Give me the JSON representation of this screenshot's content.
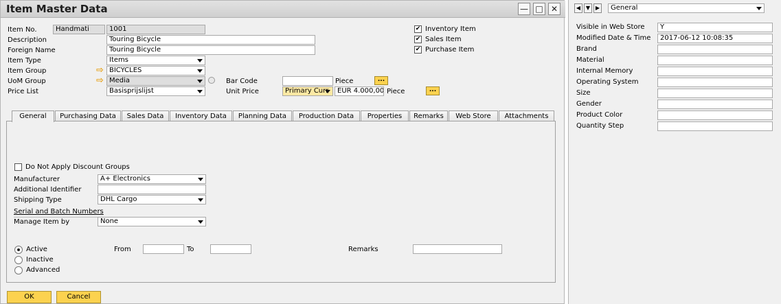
{
  "window": {
    "title": "Item Master Data",
    "minimize": "—",
    "maximize": "□",
    "close": "✕"
  },
  "header": {
    "item_no_label": "Item No.",
    "item_no_series": "Handmati",
    "item_no_value": "1001",
    "description_label": "Description",
    "description_value": "Touring Bicycle",
    "foreign_name_label": "Foreign Name",
    "foreign_name_value": "Touring Bicycle",
    "item_type_label": "Item Type",
    "item_type_value": "Items",
    "item_group_label": "Item Group",
    "item_group_value": "BICYCLES",
    "uom_group_label": "UoM Group",
    "uom_group_value": "Media",
    "price_list_label": "Price List",
    "price_list_value": "Basisprijslijst",
    "bar_code_label": "Bar Code",
    "bar_code_value": "",
    "bar_code_unit": "Piece",
    "unit_price_label": "Unit Price",
    "unit_price_currency": "Primary Curr",
    "unit_price_value": "EUR 4.000,00",
    "unit_price_unit": "Piece",
    "inventory_item_label": "Inventory Item",
    "sales_item_label": "Sales Item",
    "purchase_item_label": "Purchase Item",
    "inventory_item_checked": true,
    "sales_item_checked": true,
    "purchase_item_checked": true,
    "ellipsis": "..."
  },
  "tabs": [
    {
      "label": "General",
      "active": true
    },
    {
      "label": "Purchasing Data"
    },
    {
      "label": "Sales Data"
    },
    {
      "label": "Inventory Data"
    },
    {
      "label": "Planning Data"
    },
    {
      "label": "Production Data"
    },
    {
      "label": "Properties"
    },
    {
      "label": "Remarks"
    },
    {
      "label": "Web Store"
    },
    {
      "label": "Attachments"
    }
  ],
  "general": {
    "no_discount_label": "Do Not Apply Discount Groups",
    "no_discount_checked": false,
    "manufacturer_label": "Manufacturer",
    "manufacturer_value": "A+ Electronics",
    "additional_id_label": "Additional Identifier",
    "additional_id_value": "",
    "shipping_type_label": "Shipping Type",
    "shipping_type_value": "DHL Cargo",
    "serial_batch_label": "Serial and Batch Numbers",
    "manage_by_label": "Manage Item by",
    "manage_by_value": "None",
    "active_label": "Active",
    "inactive_label": "Inactive",
    "advanced_label": "Advanced",
    "status_selected": "Active",
    "from_label": "From",
    "from_value": "",
    "to_label": "To",
    "to_value": "",
    "remarks_label": "Remarks",
    "remarks_value": ""
  },
  "buttons": {
    "ok": "OK",
    "cancel": "Cancel"
  },
  "udf": {
    "dropdown_value": "General",
    "fields": [
      {
        "label": "Visible in Web Store",
        "value": "Y"
      },
      {
        "label": "Modified Date & Time",
        "value": "2017-06-12 10:08:35"
      },
      {
        "label": "Brand",
        "value": ""
      },
      {
        "label": "Material",
        "value": ""
      },
      {
        "label": "Internal Memory",
        "value": ""
      },
      {
        "label": "Operating System",
        "value": ""
      },
      {
        "label": "Size",
        "value": ""
      },
      {
        "label": "Gender",
        "value": ""
      },
      {
        "label": "Product Color",
        "value": ""
      },
      {
        "label": "Quantity Step",
        "value": ""
      }
    ]
  },
  "colors": {
    "accent": "#fcd24f",
    "field_yellow": "#fde9a4",
    "arrow": "#e7a21a"
  }
}
